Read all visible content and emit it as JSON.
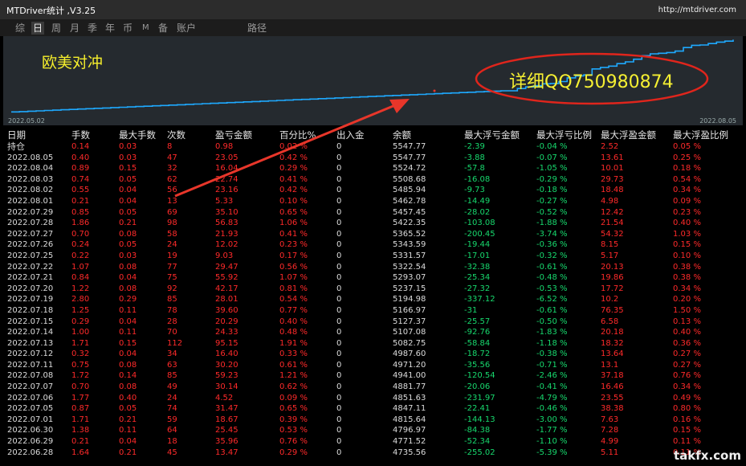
{
  "window": {
    "title": "MTDriver统计 ,V3.25",
    "url": "http://mtdriver.com"
  },
  "tabs": [
    "综",
    "日",
    "周",
    "月",
    "季",
    "年",
    "币",
    "M",
    "备",
    "账户",
    "路径"
  ],
  "active_tab": "日",
  "chart": {
    "label": "欧美对冲",
    "start_date": "2022.05.02",
    "end_date": "2022.08.05",
    "line_color": "#1ea9ff",
    "chart_data": {
      "type": "line",
      "x": [
        "2022.05.02",
        "2022.08.05"
      ],
      "y": [
        4400,
        5547.77
      ]
    }
  },
  "annotation": {
    "text": "详细QQ750980874",
    "ellipse_color": "#e0251c",
    "arrow_color": "#e8362a"
  },
  "columns": [
    "日期",
    "手数",
    "最大手数",
    "次数",
    "盈亏金额",
    "百分比%",
    "出入金",
    "余额",
    "最大浮亏金额",
    "最大浮亏比例",
    "最大浮盈金额",
    "最大浮盈比例"
  ],
  "holding": {
    "label": "持仓",
    "lots": "0.14",
    "max_lots": "0.03",
    "count": "8",
    "pnl": "0.98",
    "pct": "0.02 %",
    "inout": "0",
    "balance": "5547.77",
    "max_loss": "-2.39",
    "max_loss_pct": "-0.04 %",
    "max_gain": "2.52",
    "max_gain_pct": "0.05 %"
  },
  "rows": [
    {
      "date": "2022.08.05",
      "lots": "0.40",
      "max_lots": "0.03",
      "count": "47",
      "pnl": "23.05",
      "pct": "0.42 %",
      "inout": "0",
      "balance": "5547.77",
      "max_loss": "-3.88",
      "max_loss_pct": "-0.07 %",
      "max_gain": "13.61",
      "max_gain_pct": "0.25 %"
    },
    {
      "date": "2022.08.04",
      "lots": "0.89",
      "max_lots": "0.15",
      "count": "32",
      "pnl": "16.04",
      "pct": "0.29 %",
      "inout": "0",
      "balance": "5524.72",
      "max_loss": "-57.8",
      "max_loss_pct": "-1.05 %",
      "max_gain": "10.01",
      "max_gain_pct": "0.18 %"
    },
    {
      "date": "2022.08.03",
      "lots": "0.74",
      "max_lots": "0.05",
      "count": "62",
      "pnl": "22.74",
      "pct": "0.41 %",
      "inout": "0",
      "balance": "5508.68",
      "max_loss": "-16.08",
      "max_loss_pct": "-0.29 %",
      "max_gain": "29.73",
      "max_gain_pct": "0.54 %"
    },
    {
      "date": "2022.08.02",
      "lots": "0.55",
      "max_lots": "0.04",
      "count": "56",
      "pnl": "23.16",
      "pct": "0.42 %",
      "inout": "0",
      "balance": "5485.94",
      "max_loss": "-9.73",
      "max_loss_pct": "-0.18 %",
      "max_gain": "18.48",
      "max_gain_pct": "0.34 %"
    },
    {
      "date": "2022.08.01",
      "lots": "0.21",
      "max_lots": "0.04",
      "count": "13",
      "pnl": "5.33",
      "pct": "0.10 %",
      "inout": "0",
      "balance": "5462.78",
      "max_loss": "-14.49",
      "max_loss_pct": "-0.27 %",
      "max_gain": "4.98",
      "max_gain_pct": "0.09 %"
    },
    {
      "date": "2022.07.29",
      "lots": "0.85",
      "max_lots": "0.05",
      "count": "69",
      "pnl": "35.10",
      "pct": "0.65 %",
      "inout": "0",
      "balance": "5457.45",
      "max_loss": "-28.02",
      "max_loss_pct": "-0.52 %",
      "max_gain": "12.42",
      "max_gain_pct": "0.23 %"
    },
    {
      "date": "2022.07.28",
      "lots": "1.86",
      "max_lots": "0.21",
      "count": "98",
      "pnl": "56.83",
      "pct": "1.06 %",
      "inout": "0",
      "balance": "5422.35",
      "max_loss": "-103.08",
      "max_loss_pct": "-1.88 %",
      "max_gain": "21.54",
      "max_gain_pct": "0.40 %"
    },
    {
      "date": "2022.07.27",
      "lots": "0.70",
      "max_lots": "0.08",
      "count": "58",
      "pnl": "21.93",
      "pct": "0.41 %",
      "inout": "0",
      "balance": "5365.52",
      "max_loss": "-200.45",
      "max_loss_pct": "-3.74 %",
      "max_gain": "54.32",
      "max_gain_pct": "1.03 %"
    },
    {
      "date": "2022.07.26",
      "lots": "0.24",
      "max_lots": "0.05",
      "count": "24",
      "pnl": "12.02",
      "pct": "0.23 %",
      "inout": "0",
      "balance": "5343.59",
      "max_loss": "-19.44",
      "max_loss_pct": "-0.36 %",
      "max_gain": "8.15",
      "max_gain_pct": "0.15 %"
    },
    {
      "date": "2022.07.25",
      "lots": "0.22",
      "max_lots": "0.03",
      "count": "19",
      "pnl": "9.03",
      "pct": "0.17 %",
      "inout": "0",
      "balance": "5331.57",
      "max_loss": "-17.01",
      "max_loss_pct": "-0.32 %",
      "max_gain": "5.17",
      "max_gain_pct": "0.10 %"
    },
    {
      "date": "2022.07.22",
      "lots": "1.07",
      "max_lots": "0.08",
      "count": "77",
      "pnl": "29.47",
      "pct": "0.56 %",
      "inout": "0",
      "balance": "5322.54",
      "max_loss": "-32.38",
      "max_loss_pct": "-0.61 %",
      "max_gain": "20.13",
      "max_gain_pct": "0.38 %"
    },
    {
      "date": "2022.07.21",
      "lots": "0.84",
      "max_lots": "0.04",
      "count": "75",
      "pnl": "55.92",
      "pct": "1.07 %",
      "inout": "0",
      "balance": "5293.07",
      "max_loss": "-25.34",
      "max_loss_pct": "-0.48 %",
      "max_gain": "19.86",
      "max_gain_pct": "0.38 %"
    },
    {
      "date": "2022.07.20",
      "lots": "1.22",
      "max_lots": "0.08",
      "count": "92",
      "pnl": "42.17",
      "pct": "0.81 %",
      "inout": "0",
      "balance": "5237.15",
      "max_loss": "-27.32",
      "max_loss_pct": "-0.53 %",
      "max_gain": "17.72",
      "max_gain_pct": "0.34 %"
    },
    {
      "date": "2022.07.19",
      "lots": "2.80",
      "max_lots": "0.29",
      "count": "85",
      "pnl": "28.01",
      "pct": "0.54 %",
      "inout": "0",
      "balance": "5194.98",
      "max_loss": "-337.12",
      "max_loss_pct": "-6.52 %",
      "max_gain": "10.2",
      "max_gain_pct": "0.20 %"
    },
    {
      "date": "2022.07.18",
      "lots": "1.25",
      "max_lots": "0.11",
      "count": "78",
      "pnl": "39.60",
      "pct": "0.77 %",
      "inout": "0",
      "balance": "5166.97",
      "max_loss": "-31",
      "max_loss_pct": "-0.61 %",
      "max_gain": "76.35",
      "max_gain_pct": "1.50 %"
    },
    {
      "date": "2022.07.15",
      "lots": "0.29",
      "max_lots": "0.04",
      "count": "28",
      "pnl": "20.29",
      "pct": "0.40 %",
      "inout": "0",
      "balance": "5127.37",
      "max_loss": "-25.57",
      "max_loss_pct": "-0.50 %",
      "max_gain": "6.58",
      "max_gain_pct": "0.13 %"
    },
    {
      "date": "2022.07.14",
      "lots": "1.00",
      "max_lots": "0.11",
      "count": "70",
      "pnl": "24.33",
      "pct": "0.48 %",
      "inout": "0",
      "balance": "5107.08",
      "max_loss": "-92.76",
      "max_loss_pct": "-1.83 %",
      "max_gain": "20.18",
      "max_gain_pct": "0.40 %"
    },
    {
      "date": "2022.07.13",
      "lots": "1.71",
      "max_lots": "0.15",
      "count": "112",
      "pnl": "95.15",
      "pct": "1.91 %",
      "inout": "0",
      "balance": "5082.75",
      "max_loss": "-58.84",
      "max_loss_pct": "-1.18 %",
      "max_gain": "18.32",
      "max_gain_pct": "0.36 %"
    },
    {
      "date": "2022.07.12",
      "lots": "0.32",
      "max_lots": "0.04",
      "count": "34",
      "pnl": "16.40",
      "pct": "0.33 %",
      "inout": "0",
      "balance": "4987.60",
      "max_loss": "-18.72",
      "max_loss_pct": "-0.38 %",
      "max_gain": "13.64",
      "max_gain_pct": "0.27 %"
    },
    {
      "date": "2022.07.11",
      "lots": "0.75",
      "max_lots": "0.08",
      "count": "63",
      "pnl": "30.20",
      "pct": "0.61 %",
      "inout": "0",
      "balance": "4971.20",
      "max_loss": "-35.56",
      "max_loss_pct": "-0.71 %",
      "max_gain": "13.1",
      "max_gain_pct": "0.27 %"
    },
    {
      "date": "2022.07.08",
      "lots": "1.72",
      "max_lots": "0.14",
      "count": "85",
      "pnl": "59.23",
      "pct": "1.21 %",
      "inout": "0",
      "balance": "4941.00",
      "max_loss": "-120.54",
      "max_loss_pct": "-2.46 %",
      "max_gain": "37.18",
      "max_gain_pct": "0.76 %"
    },
    {
      "date": "2022.07.07",
      "lots": "0.70",
      "max_lots": "0.08",
      "count": "49",
      "pnl": "30.14",
      "pct": "0.62 %",
      "inout": "0",
      "balance": "4881.77",
      "max_loss": "-20.06",
      "max_loss_pct": "-0.41 %",
      "max_gain": "16.46",
      "max_gain_pct": "0.34 %"
    },
    {
      "date": "2022.07.06",
      "lots": "1.77",
      "max_lots": "0.40",
      "count": "24",
      "pnl": "4.52",
      "pct": "0.09 %",
      "inout": "0",
      "balance": "4851.63",
      "max_loss": "-231.97",
      "max_loss_pct": "-4.79 %",
      "max_gain": "23.55",
      "max_gain_pct": "0.49 %"
    },
    {
      "date": "2022.07.05",
      "lots": "0.87",
      "max_lots": "0.05",
      "count": "74",
      "pnl": "31.47",
      "pct": "0.65 %",
      "inout": "0",
      "balance": "4847.11",
      "max_loss": "-22.41",
      "max_loss_pct": "-0.46 %",
      "max_gain": "38.38",
      "max_gain_pct": "0.80 %"
    },
    {
      "date": "2022.07.01",
      "lots": "1.71",
      "max_lots": "0.21",
      "count": "59",
      "pnl": "18.67",
      "pct": "0.39 %",
      "inout": "0",
      "balance": "4815.64",
      "max_loss": "-144.13",
      "max_loss_pct": "-3.00 %",
      "max_gain": "7.63",
      "max_gain_pct": "0.16 %"
    },
    {
      "date": "2022.06.30",
      "lots": "1.38",
      "max_lots": "0.11",
      "count": "64",
      "pnl": "25.45",
      "pct": "0.53 %",
      "inout": "0",
      "balance": "4796.97",
      "max_loss": "-84.38",
      "max_loss_pct": "-1.77 %",
      "max_gain": "7.28",
      "max_gain_pct": "0.15 %"
    },
    {
      "date": "2022.06.29",
      "lots": "0.21",
      "max_lots": "0.04",
      "count": "18",
      "pnl": "35.96",
      "pct": "0.76 %",
      "inout": "0",
      "balance": "4771.52",
      "max_loss": "-52.34",
      "max_loss_pct": "-1.10 %",
      "max_gain": "4.99",
      "max_gain_pct": "0.11 %"
    },
    {
      "date": "2022.06.28",
      "lots": "1.64",
      "max_lots": "0.21",
      "count": "45",
      "pnl": "13.47",
      "pct": "0.29 %",
      "inout": "0",
      "balance": "4735.56",
      "max_loss": "-255.02",
      "max_loss_pct": "-5.39 %",
      "max_gain": "5.11",
      "max_gain_pct": "0.11 %"
    }
  ],
  "watermark": "takfx.com"
}
